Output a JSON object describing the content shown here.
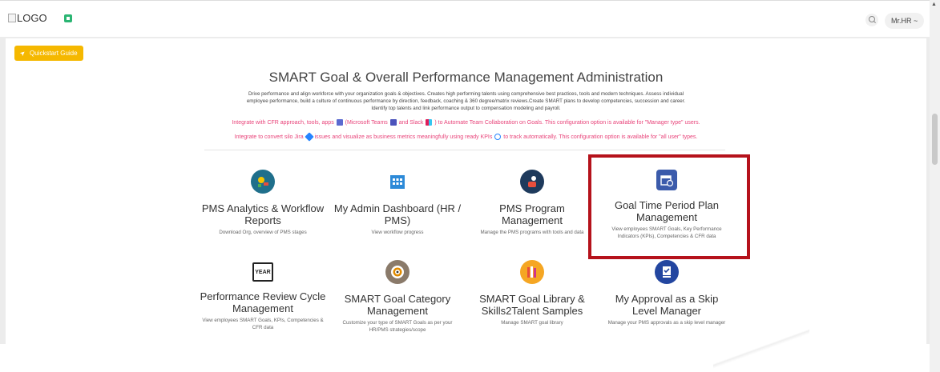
{
  "header": {
    "logo_alt": "LOGO",
    "user_label": "Mr.HR ~"
  },
  "quickstart_label": "Quickstart Guide",
  "title": "SMART Goal & Overall Performance Management Administration",
  "description_lines": [
    "Drive performance and align workforce with your organization goals & objectives. Creates high performing talents using comprehensive best practices, tools and modern techniques. Assess individual",
    "employee performance, build a culture of continuous performance by direction, feedback, coaching & 360 degree/matrix reviews.Create SMART plans to develop competencies, succession and career.",
    "Identify top talents and link performance output to compensation modeling and payroll."
  ],
  "integration_lines": {
    "line1_a": "Integrate with CFR approach, tools, apps",
    "line1_b": "(Microsoft Teams",
    "line1_c": "and Slack",
    "line1_d": ") to Automate Team Collaboration on Goals. This configuration option is available for \"Manager type\" users.",
    "line2_a": "Integrate to convert silo Jira",
    "line2_b": "issues and visualize as business metrics meaningfully using ready KPIs",
    "line2_c": "to track automatically. This configuration option is available for \"all user\" types."
  },
  "cards": [
    {
      "icon": "analytics-icon",
      "title": "PMS Analytics & Workflow Reports",
      "sub": "Download Org, overview of PMS stages"
    },
    {
      "icon": "dashboard-icon",
      "title": "My Admin Dashboard (HR / PMS)",
      "sub": "View workflow progress"
    },
    {
      "icon": "program-icon",
      "title": "PMS Program Management",
      "sub": "Manage the PMS programs with tools and data"
    },
    {
      "icon": "calendar-icon",
      "title": "Goal Time Period Plan Management",
      "sub": "View employees SMART Goals, Key Performance Indicators (KPIs), Competencies & CFR data"
    },
    {
      "icon": "year-icon",
      "icon_text": "YEAR",
      "title": "Performance Review Cycle Management",
      "sub": "View employees SMART Goals, KPIs, Competencies & CFR data"
    },
    {
      "icon": "target-icon",
      "title": "SMART Goal Category Management",
      "sub": "Customize your type of SMART Goals as per your HR/PMS strategies/scope"
    },
    {
      "icon": "library-icon",
      "title": "SMART Goal Library & Skills2Talent Samples",
      "sub": "Manage SMART goal library"
    },
    {
      "icon": "approval-icon",
      "title": "My Approval as a Skip Level Manager",
      "sub": "Manage your PMS approvals as a skip level manager"
    }
  ],
  "colors": {
    "accent": "#f5b800",
    "highlight": "#b5121b",
    "pink": "#e8447a"
  }
}
